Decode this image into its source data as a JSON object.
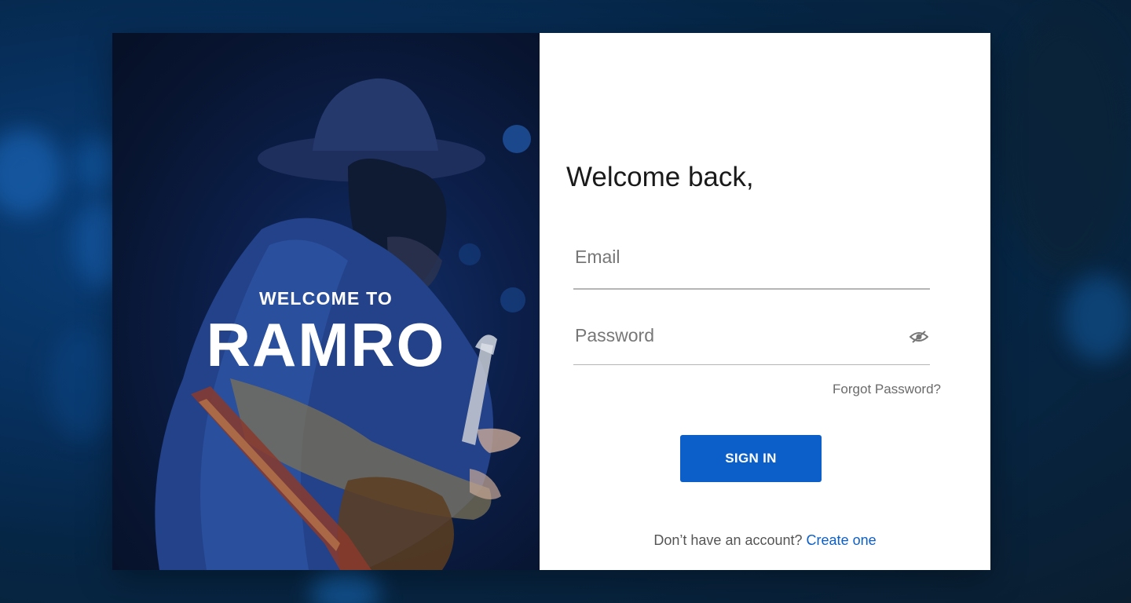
{
  "hero": {
    "welcome_to": "WELCOME TO",
    "brand": "RAMRO"
  },
  "form": {
    "greeting": "Welcome back,",
    "email_placeholder": "Email",
    "password_placeholder": "Password",
    "show_password_icon": "eye-slash-icon",
    "forgot_password": "Forgot Password?",
    "signin_label": "SIGN IN",
    "no_account_text": "Don’t have an account?",
    "create_link": "Create one"
  },
  "colors": {
    "accent": "#0c5ec8",
    "background": "#07305e",
    "panel": "#ffffff"
  }
}
